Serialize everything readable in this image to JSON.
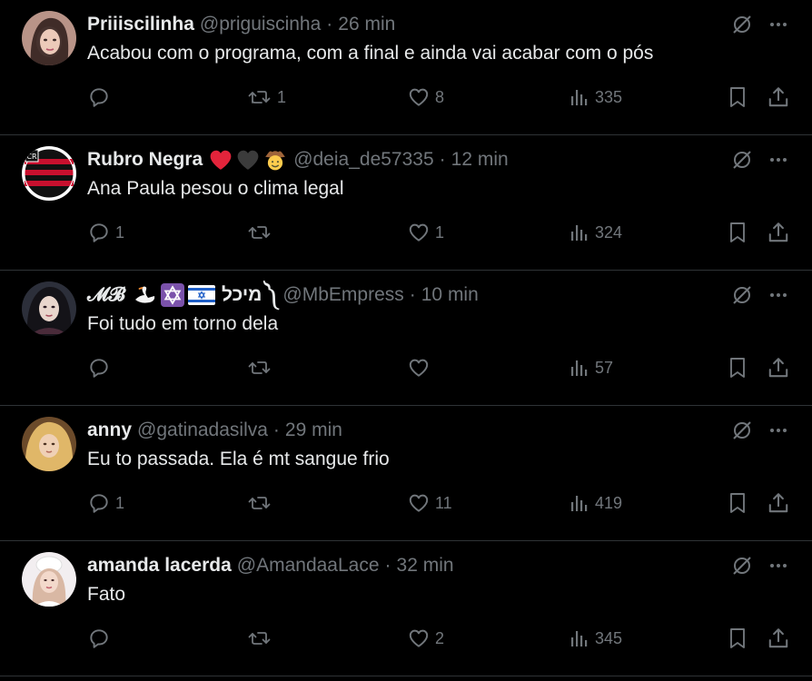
{
  "tweets": [
    {
      "name": "Priiiscilinha",
      "handle": "@priguiscinha",
      "separator": "·",
      "time": "26 min",
      "text": "Acabou com o programa, com a final e ainda vai acabar com o pós",
      "replies": "",
      "retweets": "1",
      "likes": "8",
      "views": "335",
      "avatar_color": "#c9a7a0"
    },
    {
      "name": "Rubro Negra",
      "name_emojis": [
        "red-heart-icon",
        "black-heart-icon",
        "cowboy-face-icon"
      ],
      "handle": "@deia_de57335",
      "separator": "·",
      "time": "12 min",
      "text": "Ana Paula pesou o clima legal",
      "replies": "1",
      "retweets": "",
      "likes": "1",
      "views": "324",
      "avatar_color": "#b01e24"
    },
    {
      "name_prefix": "𝓜𝓑",
      "name_emojis": [
        "swan-icon",
        "star-of-david-icon",
        "israel-flag-icon"
      ],
      "name": "מיכל",
      "name_suffix": "༽",
      "handle": "@MbEmpress",
      "separator": "·",
      "time": "10 min",
      "text": "Foi tudo em torno dela",
      "replies": "",
      "retweets": "",
      "likes": "",
      "views": "57",
      "avatar_color": "#3a3a44"
    },
    {
      "name": "anny",
      "handle": "@gatinadasilva",
      "separator": "·",
      "time": "29 min",
      "text": "Eu to passada. Ela é mt sangue frio",
      "replies": "1",
      "retweets": "",
      "likes": "11",
      "views": "419",
      "avatar_color": "#d7b067"
    },
    {
      "name": "amanda lacerda",
      "handle": "@AmandaaLace",
      "separator": "·",
      "time": "32 min",
      "text": "Fato",
      "replies": "",
      "retweets": "",
      "likes": "2",
      "views": "345",
      "avatar_color": "#eae4e6"
    }
  ],
  "colors": {
    "background": "#000000",
    "primary_text": "#e7e9ea",
    "secondary_text": "#71767b",
    "divider": "#2f3336"
  }
}
